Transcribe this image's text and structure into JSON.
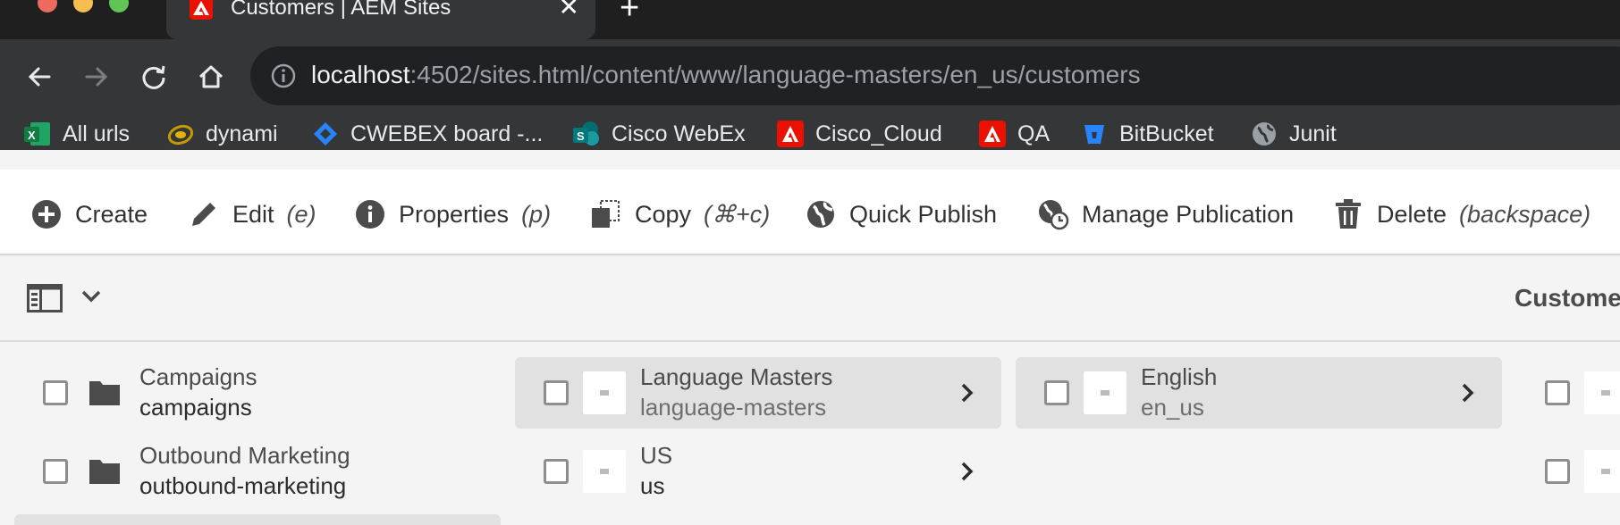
{
  "browser": {
    "tab": {
      "title": "Customers | AEM Sites",
      "close": "✕"
    },
    "new_tab": "+",
    "url": {
      "host": "localhost",
      "rest": ":4502/sites.html/content/www/language-masters/en_us/customers"
    },
    "bookmarks": [
      {
        "label": "All urls",
        "icon": "excel-icon"
      },
      {
        "label": "dynami",
        "icon": "dynamics-icon"
      },
      {
        "label": "CWEBEX board -...",
        "icon": "jira-icon"
      },
      {
        "label": "Cisco WebEx",
        "icon": "sharepoint-icon"
      },
      {
        "label": "Cisco_Cloud",
        "icon": "adobe-icon"
      },
      {
        "label": "QA",
        "icon": "adobe-icon"
      },
      {
        "label": "BitBucket",
        "icon": "bitbucket-icon"
      },
      {
        "label": "Junit",
        "icon": "globe-icon"
      }
    ]
  },
  "actions": [
    {
      "label": "Create",
      "shortcut": ""
    },
    {
      "label": "Edit",
      "shortcut": "(e)"
    },
    {
      "label": "Properties",
      "shortcut": "(p)"
    },
    {
      "label": "Copy",
      "shortcut": "(⌘+c)"
    },
    {
      "label": "Quick Publish",
      "shortcut": ""
    },
    {
      "label": "Manage Publication",
      "shortcut": ""
    },
    {
      "label": "Delete",
      "shortcut": "(backspace)"
    }
  ],
  "header": {
    "title": "Customer"
  },
  "columns": {
    "col1": [
      {
        "title": "Campaigns",
        "name": "campaigns"
      },
      {
        "title": "Outbound Marketing",
        "name": "outbound-marketing"
      }
    ],
    "col2": [
      {
        "title": "Language Masters",
        "name": "language-masters"
      },
      {
        "title": "US",
        "name": "us"
      }
    ],
    "col3": [
      {
        "title": "English",
        "name": "en_us"
      }
    ]
  },
  "colors": {
    "accent": "#eb1000",
    "chrome_dark": "#1f1f20",
    "chrome": "#353638"
  }
}
